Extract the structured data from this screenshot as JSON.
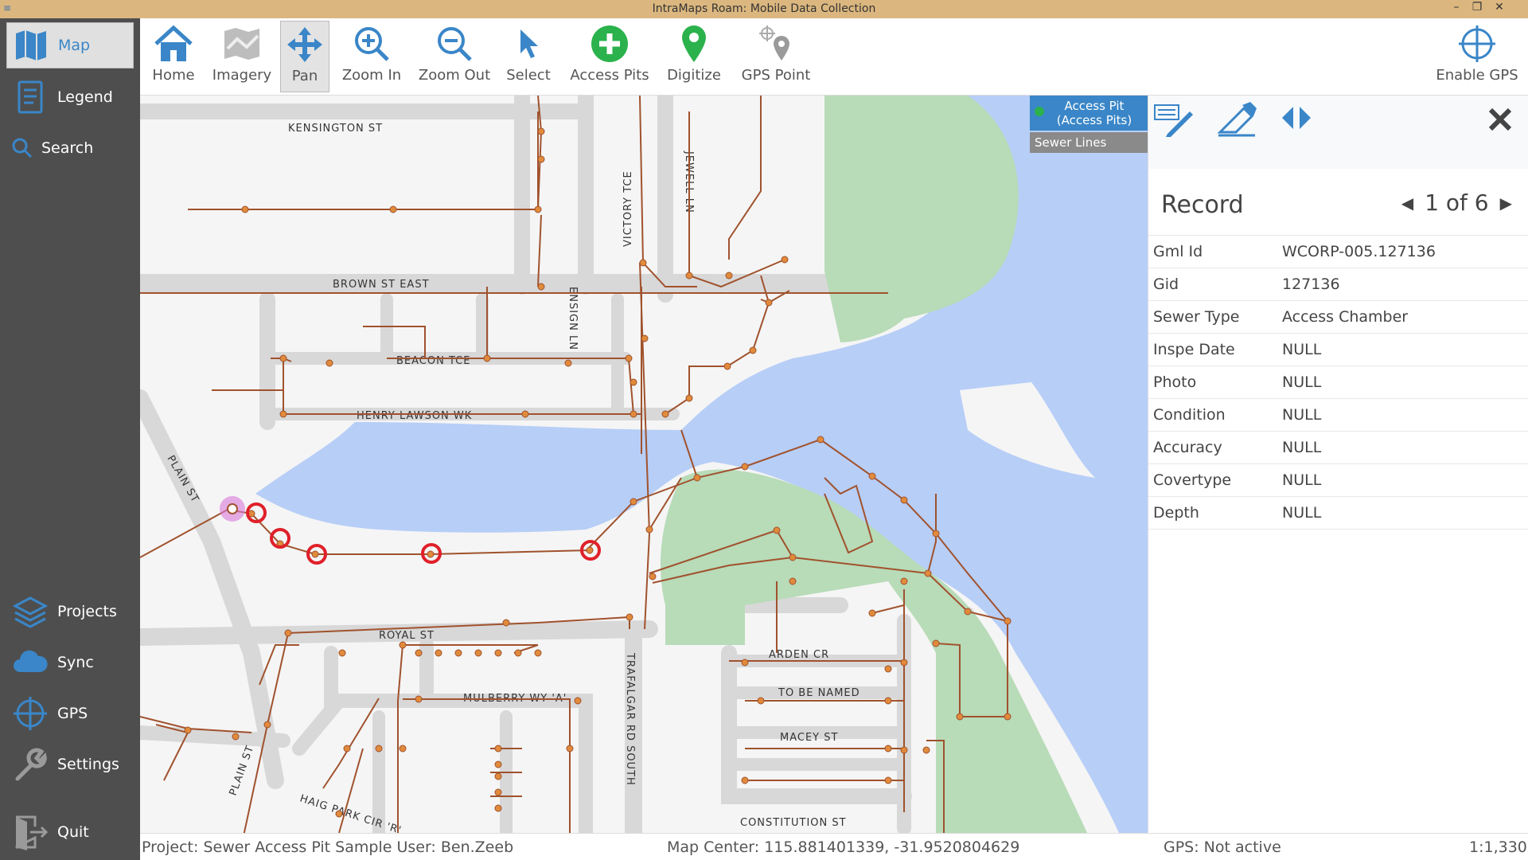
{
  "window": {
    "title": "IntraMaps Roam: Mobile Data Collection"
  },
  "sidebar": {
    "items": [
      {
        "label": "Map"
      },
      {
        "label": "Legend"
      },
      {
        "label": "Search"
      },
      {
        "label": "Projects"
      },
      {
        "label": "Sync"
      },
      {
        "label": "GPS"
      },
      {
        "label": "Settings"
      },
      {
        "label": "Quit"
      }
    ]
  },
  "toolbar": {
    "tools": [
      {
        "label": "Home"
      },
      {
        "label": "Imagery"
      },
      {
        "label": "Pan"
      },
      {
        "label": "Zoom In"
      },
      {
        "label": "Zoom Out"
      },
      {
        "label": "Select"
      },
      {
        "label": "Access Pits"
      },
      {
        "label": "Digitize"
      },
      {
        "label": "GPS Point"
      }
    ],
    "enable_gps": "Enable GPS"
  },
  "layers": {
    "items": [
      {
        "label": "Access Pit (Access Pits)"
      },
      {
        "label": "Sewer Lines"
      }
    ]
  },
  "record": {
    "title": "Record",
    "position": "1 of 6",
    "fields": [
      {
        "key": "Gml Id",
        "value": "WCORP-005.127136"
      },
      {
        "key": "Gid",
        "value": "127136"
      },
      {
        "key": "Sewer Type",
        "value": "Access Chamber"
      },
      {
        "key": "Inspe Date",
        "value": "NULL"
      },
      {
        "key": "Photo",
        "value": "NULL"
      },
      {
        "key": "Condition",
        "value": "NULL"
      },
      {
        "key": "Accuracy",
        "value": "NULL"
      },
      {
        "key": "Covertype",
        "value": "NULL"
      },
      {
        "key": "Depth",
        "value": "NULL"
      }
    ]
  },
  "map": {
    "street_labels": {
      "kensington": "KENSINGTON ST",
      "brown": "BROWN ST EAST",
      "beacon": "BEACON TCE",
      "henry": "HENRY LAWSON WK",
      "victory": "VICTORY TCE",
      "jewell": "JEWELL LN",
      "ensign": "ENSIGN LN",
      "plain": "PLAIN ST",
      "plain2": "PLAIN ST",
      "royal": "ROYAL ST",
      "mulberry": "MULBERRY WY 'A'",
      "trafalgar": "TRAFALGAR RD SOUTH",
      "arden": "ARDEN CR",
      "tobe": "TO BE NAMED",
      "macey": "MACEY ST",
      "constitution": "CONSTITUTION ST",
      "haig": "HAIG PARK CIR 'R'"
    }
  },
  "status": {
    "project": "Project: Sewer Access Pit Sample User: Ben.Zeeb",
    "map_center": "Map Center: 115.881401339, -31.9520804629",
    "gps": "GPS: Not active",
    "scale": "1:1,330"
  },
  "colors": {
    "accent": "#3a86c8",
    "sidebar": "#4e4e4e",
    "titlebar": "#dbb77f",
    "water": "#b7cef7",
    "park": "#b8dbb8",
    "sewer": "#a0522d",
    "selected": "#e0202a"
  }
}
